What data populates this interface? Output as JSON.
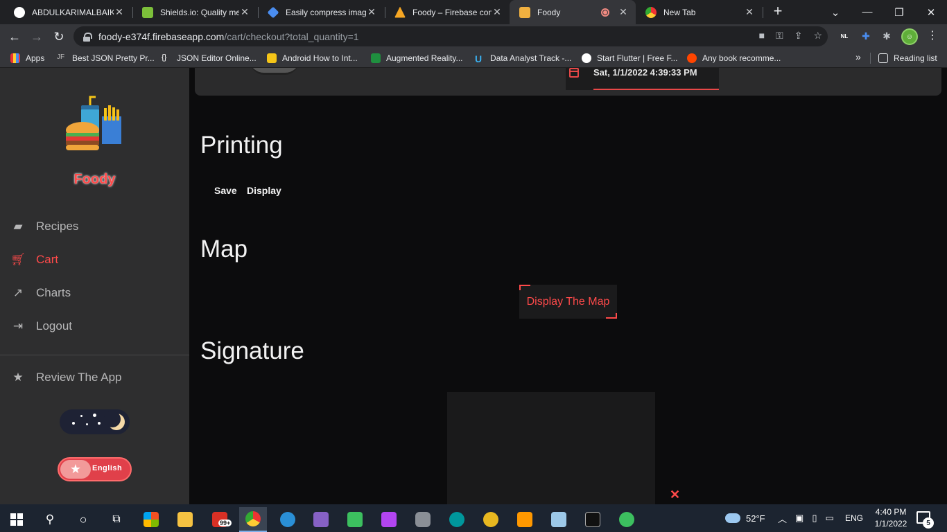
{
  "browser": {
    "tabs": [
      {
        "title": "ABDULKARIMALBAIK/",
        "favicon": "github-icon",
        "color": "#ffffff"
      },
      {
        "title": "Shields.io: Quality met",
        "favicon": "shields-icon",
        "color": "#7cbf3a"
      },
      {
        "title": "Easily compress image",
        "favicon": "diamond-icon",
        "color": "#4a8df0"
      },
      {
        "title": "Foody – Firebase cons",
        "favicon": "firebase-icon",
        "color": "#f5a623"
      },
      {
        "title": "Foody",
        "favicon": "foody-icon",
        "color": "#f0b040",
        "active": true,
        "recording": true
      },
      {
        "title": "New Tab",
        "favicon": "chrome-icon",
        "color": "#dddddd"
      }
    ],
    "url_host": "foody-e374f.firebaseapp.com",
    "url_path": "/cart/checkout?total_quantity=1",
    "bookmarks": [
      {
        "label": "Apps",
        "icon": "apps-grid-icon"
      },
      {
        "label": "Best JSON Pretty Pr...",
        "icon": "jf-icon"
      },
      {
        "label": "JSON Editor Online...",
        "icon": "braces-icon"
      },
      {
        "label": "Android How to Int...",
        "icon": "android-icon"
      },
      {
        "label": "Augmented Reality...",
        "icon": "ar-icon"
      },
      {
        "label": "Data Analyst Track -...",
        "icon": "udacity-icon"
      },
      {
        "label": "Start Flutter | Free F...",
        "icon": "globe-icon"
      },
      {
        "label": "Any book recomme...",
        "icon": "reddit-icon"
      }
    ],
    "bookmarks_more": "»",
    "reading_list": "Reading list",
    "extension_badge": "NL"
  },
  "app": {
    "brand": "Foody",
    "nav": [
      {
        "label": "Recipes",
        "icon": "recipes-icon"
      },
      {
        "label": "Cart",
        "icon": "cart-icon",
        "active": true
      },
      {
        "label": "Charts",
        "icon": "charts-icon"
      },
      {
        "label": "Logout",
        "icon": "logout-icon"
      }
    ],
    "review": "Review The App",
    "language": "English",
    "date_value": "Sat, 1/1/2022 4:39:33 PM",
    "sections": {
      "printing": "Printing",
      "save": "Save",
      "display": "Display",
      "map": "Map",
      "display_map": "Display The Map",
      "signature": "Signature",
      "clear": "✕"
    },
    "accent": "#ff4a4a"
  },
  "taskbar": {
    "weather": "52°F",
    "lang": "ENG",
    "time": "4:40 PM",
    "date": "1/1/2022",
    "notif_count": "5",
    "mail_badge": "99+"
  }
}
